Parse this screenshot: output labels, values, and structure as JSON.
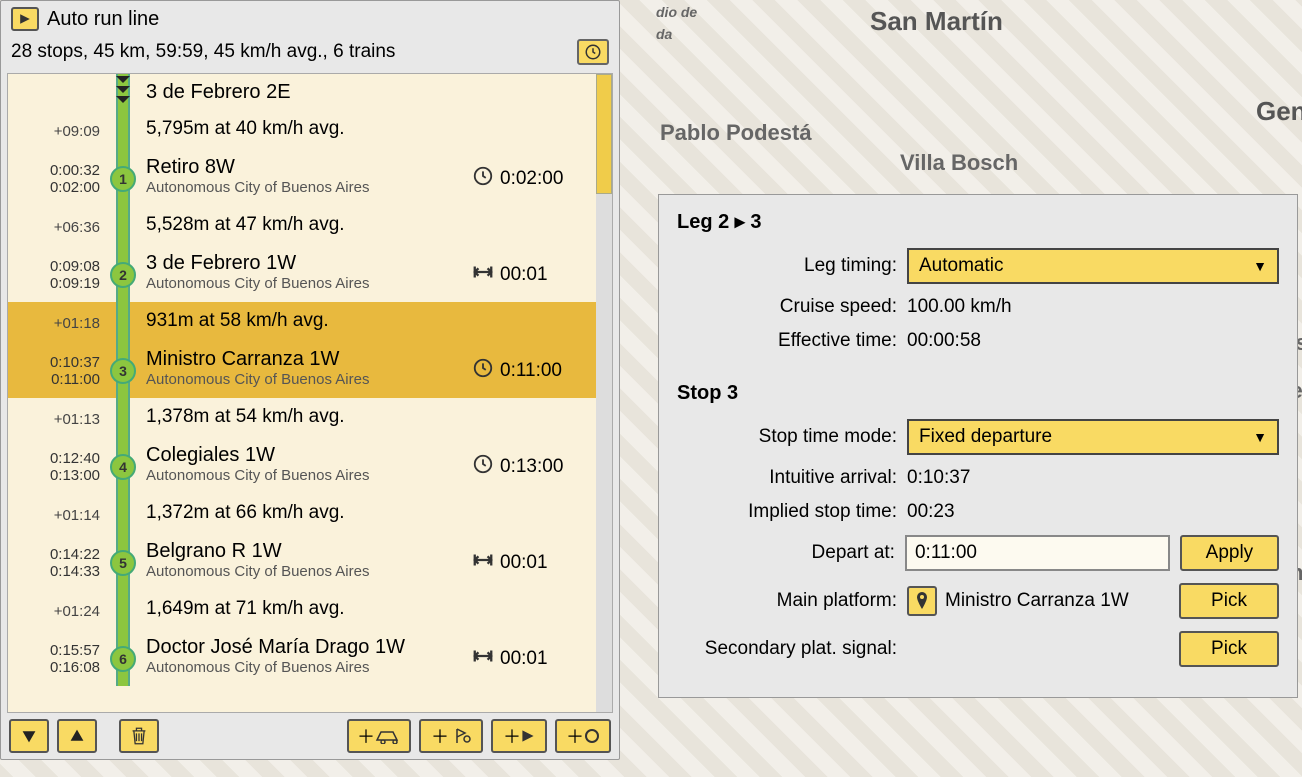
{
  "header": {
    "auto_run_label": "Auto run line",
    "summary": "28 stops, 45 km, 59:59, 45 km/h avg., 6 trains"
  },
  "origin": {
    "name": "3 de Febrero 2E"
  },
  "stops": [
    {
      "num": "1",
      "plus": "+09:09",
      "leg": "5,795m at 40 km/h avg.",
      "t1": "0:00:32",
      "t2": "0:02:00",
      "name": "Retiro 8W",
      "sub": "Autonomous City of Buenos Aires",
      "right_type": "clock",
      "right_val": "0:02:00"
    },
    {
      "num": "2",
      "plus": "+06:36",
      "leg": "5,528m at 47 km/h avg.",
      "t1": "0:09:08",
      "t2": "0:09:19",
      "name": "3 de Febrero 1W",
      "sub": "Autonomous City of Buenos Aires",
      "right_type": "margin",
      "right_val": "00:01"
    },
    {
      "num": "3",
      "plus": "+01:18",
      "leg": "931m at 58 km/h avg.",
      "t1": "0:10:37",
      "t2": "0:11:00",
      "name": "Ministro Carranza 1W",
      "sub": "Autonomous City of Buenos Aires",
      "right_type": "clock",
      "right_val": "0:11:00",
      "selected": true
    },
    {
      "num": "4",
      "plus": "+01:13",
      "leg": "1,378m at 54 km/h avg.",
      "t1": "0:12:40",
      "t2": "0:13:00",
      "name": "Colegiales 1W",
      "sub": "Autonomous City of Buenos Aires",
      "right_type": "clock",
      "right_val": "0:13:00"
    },
    {
      "num": "5",
      "plus": "+01:14",
      "leg": "1,372m at 66 km/h avg.",
      "t1": "0:14:22",
      "t2": "0:14:33",
      "name": "Belgrano R 1W",
      "sub": "Autonomous City of Buenos Aires",
      "right_type": "margin",
      "right_val": "00:01"
    },
    {
      "num": "6",
      "plus": "+01:24",
      "leg": "1,649m at 71 km/h avg.",
      "t1": "0:15:57",
      "t2": "0:16:08",
      "name": "Doctor José María Drago 1W",
      "sub": "Autonomous City of Buenos Aires",
      "right_type": "margin",
      "right_val": "00:01"
    }
  ],
  "detail": {
    "leg_heading": "Leg 2 ▸ 3",
    "leg_timing_label": "Leg timing:",
    "leg_timing_value": "Automatic",
    "cruise_label": "Cruise speed:",
    "cruise_value": "100.00 km/h",
    "eff_label": "Effective time:",
    "eff_value": "00:00:58",
    "stop_heading": "Stop 3",
    "stop_mode_label": "Stop time mode:",
    "stop_mode_value": "Fixed departure",
    "intuitive_label": "Intuitive arrival:",
    "intuitive_value": "0:10:37",
    "implied_label": "Implied stop time:",
    "implied_value": "00:23",
    "depart_label": "Depart at:",
    "depart_value": "0:11:00",
    "apply_label": "Apply",
    "platform_label": "Main platform:",
    "platform_value": "Ministro Carranza 1W",
    "pick_label": "Pick",
    "secondary_label": "Secondary plat. signal:"
  },
  "map_labels": {
    "san_martin": "San Martín",
    "podesta": "Pablo Podestá",
    "villa_bosch": "Villa Bosch",
    "gen": "Gen",
    "dio": "dio de",
    "da": "da",
    "os": "os",
    "re": "re",
    "in": "In"
  }
}
